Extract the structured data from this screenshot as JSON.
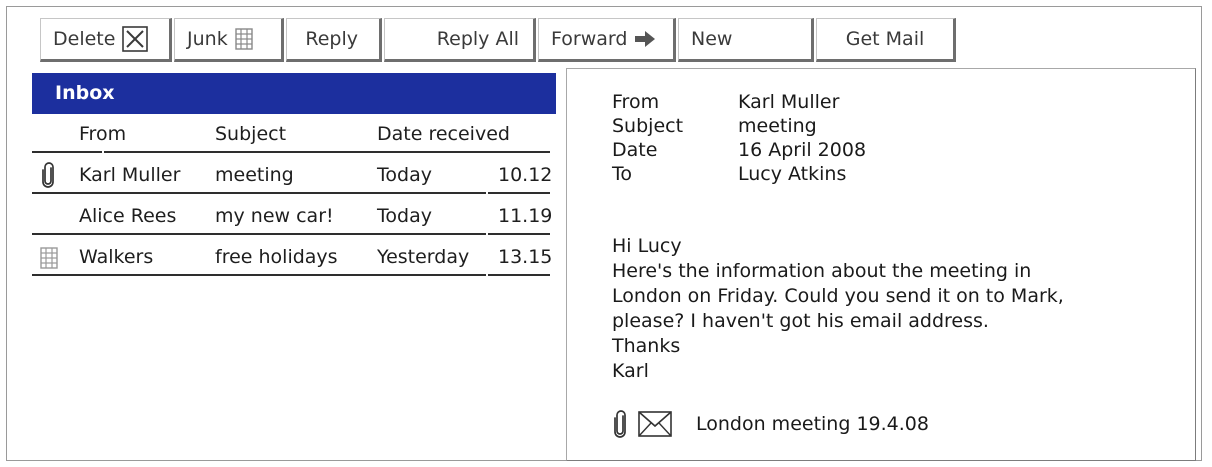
{
  "toolbar": {
    "delete": "Delete",
    "junk": "Junk",
    "reply": "Reply",
    "reply_all": "Reply All",
    "forward": "Forward",
    "new": "New",
    "get_mail": "Get Mail"
  },
  "inbox": {
    "title": "Inbox",
    "columns": {
      "from": "From",
      "subject": "Subject",
      "date": "Date received"
    },
    "rows": [
      {
        "icon": "paperclip-icon",
        "from": "Karl Muller",
        "subject": "meeting",
        "date": "Today",
        "time": "10.12"
      },
      {
        "icon": "",
        "from": "Alice Rees",
        "subject": "my new car!",
        "date": "Today",
        "time": "11.19"
      },
      {
        "icon": "junk-icon",
        "from": "Walkers",
        "subject": "free holidays",
        "date": "Yesterday",
        "time": "13.15"
      }
    ]
  },
  "message": {
    "from_label": "From",
    "from": "Karl Muller",
    "subject_label": "Subject",
    "subject": "meeting",
    "date_label": "Date",
    "date": "16 April 2008",
    "to_label": "To",
    "to": "Lucy Atkins",
    "body": [
      "Hi Lucy",
      "Here's the information about the meeting in",
      "London on Friday. Could you send it on to Mark,",
      "please? I haven't got his email address.",
      "Thanks",
      "Karl"
    ],
    "attachment": "London meeting 19.4.08"
  },
  "colors": {
    "inbox_header": "#1c2f9e"
  }
}
